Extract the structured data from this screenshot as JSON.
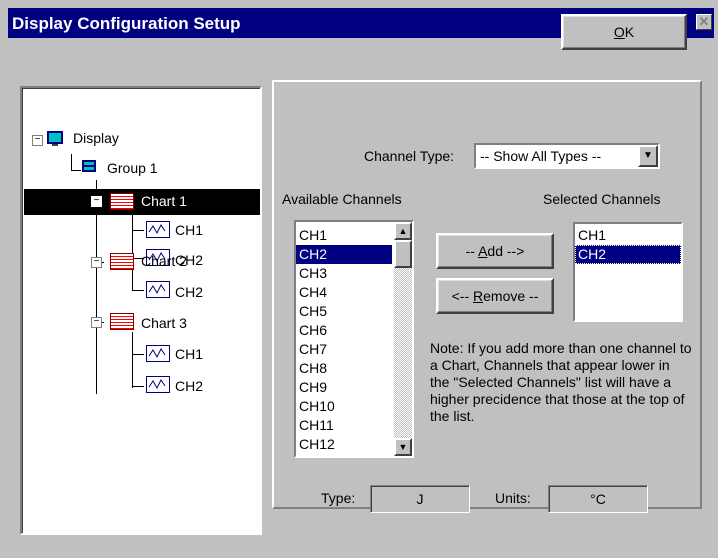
{
  "window": {
    "title": "Display Configuration  Setup",
    "close_glyph": "✕"
  },
  "buttons": {
    "ok": {
      "prefix": "",
      "mnemonic": "O",
      "suffix": "K"
    },
    "add": {
      "prefix": "-- ",
      "mnemonic": "A",
      "suffix": "dd -->"
    },
    "remove": {
      "prefix": "<-- ",
      "mnemonic": "R",
      "suffix": "emove --"
    }
  },
  "tree": {
    "root": {
      "label": "Display",
      "icon": "display-icon"
    },
    "group": {
      "label": "Group 1",
      "icon": "group-icon"
    },
    "charts": [
      {
        "label": "Chart 1",
        "selected": true,
        "channels": [
          "CH1",
          "CH2"
        ]
      },
      {
        "label": "Chart 2",
        "selected": false,
        "channels": [
          "CH2"
        ]
      },
      {
        "label": "Chart 3",
        "selected": false,
        "channels": [
          "CH1",
          "CH2"
        ]
      }
    ]
  },
  "channel_type": {
    "label": "Channel Type:",
    "value": "-- Show All Types --"
  },
  "available": {
    "label": "Available Channels",
    "items": [
      "CH1",
      "CH2",
      "CH3",
      "CH4",
      "CH5",
      "CH6",
      "CH7",
      "CH8",
      "CH9",
      "CH10",
      "CH11",
      "CH12"
    ],
    "selected_index": 1
  },
  "selected": {
    "label": "Selected Channels",
    "items": [
      "CH1",
      "CH2"
    ],
    "selected_index": 1
  },
  "note": "Note:  If you add more than one channel to a Chart, Channels that appear lower in the \"Selected Channels\" list will have a higher precidence that those at the top of the list.",
  "type_field": {
    "label": "Type:",
    "value": "J"
  },
  "units_field": {
    "label": "Units:",
    "value": "°C"
  },
  "colors": {
    "titlebar": "#000080",
    "face": "#c0c0c0",
    "highlight": "#000080"
  }
}
